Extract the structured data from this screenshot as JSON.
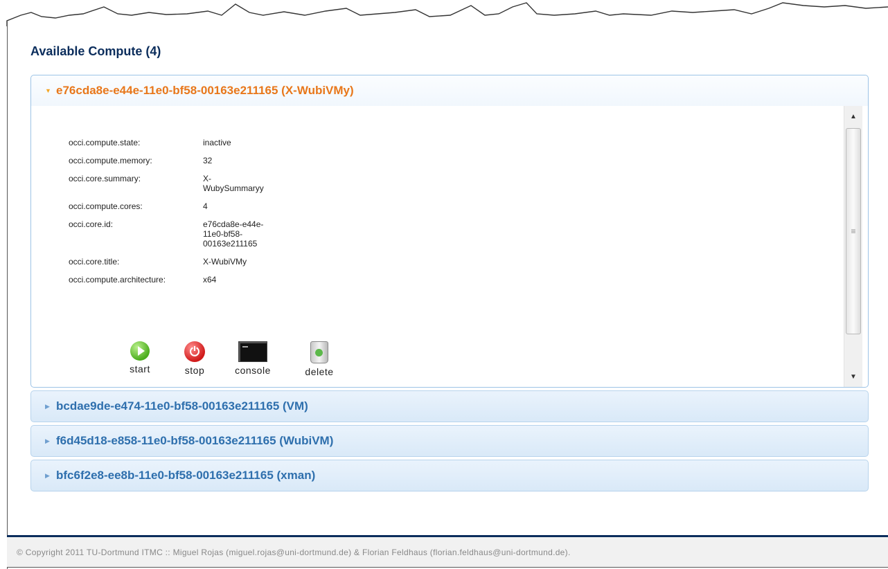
{
  "main": {
    "heading": "Available Compute (4)"
  },
  "compute": [
    {
      "title": "e76cda8e-e44e-11e0-bf58-00163e211165 (X-WubiVMy)",
      "expanded": true,
      "properties": [
        {
          "key": "occi.compute.state:",
          "value": "inactive"
        },
        {
          "key": "occi.compute.memory:",
          "value": "32"
        },
        {
          "key": "occi.core.summary:",
          "value": "X-\nWubySummaryy"
        },
        {
          "key": "occi.compute.cores:",
          "value": "4"
        },
        {
          "key": "occi.core.id:",
          "value": "e76cda8e-e44e-\n11e0-bf58-\n00163e211165"
        },
        {
          "key": "occi.core.title:",
          "value": "X-WubiVMy"
        },
        {
          "key": "occi.compute.architecture:",
          "value": "x64"
        }
      ],
      "actions": [
        {
          "label": "start",
          "icon": "play-icon"
        },
        {
          "label": "stop",
          "icon": "power-icon"
        },
        {
          "label": "console",
          "icon": "console-icon"
        },
        {
          "label": "delete",
          "icon": "trash-icon"
        }
      ]
    },
    {
      "title": "bcdae9de-e474-11e0-bf58-00163e211165 (VM)",
      "expanded": false
    },
    {
      "title": "f6d45d18-e858-11e0-bf58-00163e211165 (WubiVM)",
      "expanded": false
    },
    {
      "title": "bfc6f2e8-ee8b-11e0-bf58-00163e211165 (xman)",
      "expanded": false
    }
  ],
  "footer": {
    "text": "© Copyright 2011 TU-Dortmund ITMC :: Miguel Rojas (miguel.rojas@uni-dortmund.de) & Florian Feldhaus (florian.feldhaus@uni-dortmund.de)."
  },
  "colors": {
    "heading": "#0b2d5c",
    "active_title": "#e8771a",
    "inactive_title": "#2e6fad",
    "footer_bar": "#0b2d5c"
  }
}
